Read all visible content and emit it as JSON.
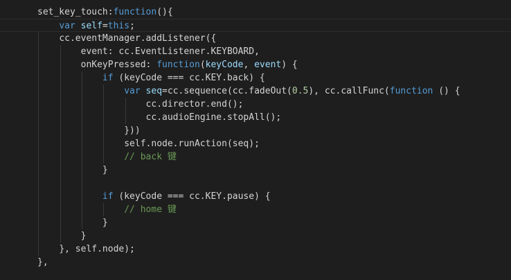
{
  "colors": {
    "background": "#1e1e1e",
    "keyword": "#569cd6",
    "identifier": "#9cdcfe",
    "number": "#b5cea8",
    "comment": "#6a9955",
    "plain": "#d4d4d4"
  },
  "editor": {
    "current_line_index": 1,
    "lines": [
      [
        {
          "t": "set_key_touch",
          "c": "pl"
        },
        {
          "t": ":",
          "c": "pl"
        },
        {
          "t": "function",
          "c": "kw"
        },
        {
          "t": "(){",
          "c": "pl"
        }
      ],
      [
        {
          "t": "    "
        },
        {
          "t": "var",
          "c": "kw"
        },
        {
          "t": " ",
          "c": "pl"
        },
        {
          "t": "self",
          "c": "id"
        },
        {
          "t": "=",
          "c": "pl"
        },
        {
          "t": "this",
          "c": "kw"
        },
        {
          "t": ";",
          "c": "pl"
        }
      ],
      [
        {
          "t": "    "
        },
        {
          "t": "cc.eventManager.addListener({",
          "c": "pl"
        }
      ],
      [
        {
          "t": "        "
        },
        {
          "t": "event: cc.EventListener.KEYBOARD,",
          "c": "pl"
        }
      ],
      [
        {
          "t": "        "
        },
        {
          "t": "onKeyPressed: ",
          "c": "pl"
        },
        {
          "t": "function",
          "c": "kw"
        },
        {
          "t": "(",
          "c": "pl"
        },
        {
          "t": "keyCode",
          "c": "id"
        },
        {
          "t": ", ",
          "c": "pl"
        },
        {
          "t": "event",
          "c": "id"
        },
        {
          "t": ") {",
          "c": "pl"
        }
      ],
      [
        {
          "t": "            "
        },
        {
          "t": "if",
          "c": "kw"
        },
        {
          "t": " (keyCode === cc.KEY.back) {",
          "c": "pl"
        }
      ],
      [
        {
          "t": "                "
        },
        {
          "t": "var",
          "c": "kw"
        },
        {
          "t": " ",
          "c": "pl"
        },
        {
          "t": "seq",
          "c": "id"
        },
        {
          "t": "=cc.sequence(cc.fadeOut(",
          "c": "pl"
        },
        {
          "t": "0.5",
          "c": "num"
        },
        {
          "t": "), cc.callFunc(",
          "c": "pl"
        },
        {
          "t": "function",
          "c": "kw"
        },
        {
          "t": " () {",
          "c": "pl"
        }
      ],
      [
        {
          "t": "                    "
        },
        {
          "t": "cc.director.end();",
          "c": "pl"
        }
      ],
      [
        {
          "t": "                    "
        },
        {
          "t": "cc.audioEngine.stopAll();",
          "c": "pl"
        }
      ],
      [
        {
          "t": "                "
        },
        {
          "t": "}))",
          "c": "pl"
        }
      ],
      [
        {
          "t": "                "
        },
        {
          "t": "self.node.runAction(seq);",
          "c": "pl"
        }
      ],
      [
        {
          "t": "                "
        },
        {
          "t": "// back 键",
          "c": "cm"
        }
      ],
      [
        {
          "t": "            "
        },
        {
          "t": "}",
          "c": "pl"
        }
      ],
      [
        {
          "t": ""
        }
      ],
      [
        {
          "t": "            "
        },
        {
          "t": "if",
          "c": "kw"
        },
        {
          "t": " (keyCode === cc.KEY.pause) {",
          "c": "pl"
        }
      ],
      [
        {
          "t": "                "
        },
        {
          "t": "// home 键",
          "c": "cm"
        }
      ],
      [
        {
          "t": "            "
        },
        {
          "t": "}",
          "c": "pl"
        }
      ],
      [
        {
          "t": "        "
        },
        {
          "t": "}",
          "c": "pl"
        }
      ],
      [
        {
          "t": "    "
        },
        {
          "t": "}, self.node);",
          "c": "pl"
        }
      ],
      [
        {
          "t": "},",
          "c": "pl"
        }
      ]
    ]
  }
}
